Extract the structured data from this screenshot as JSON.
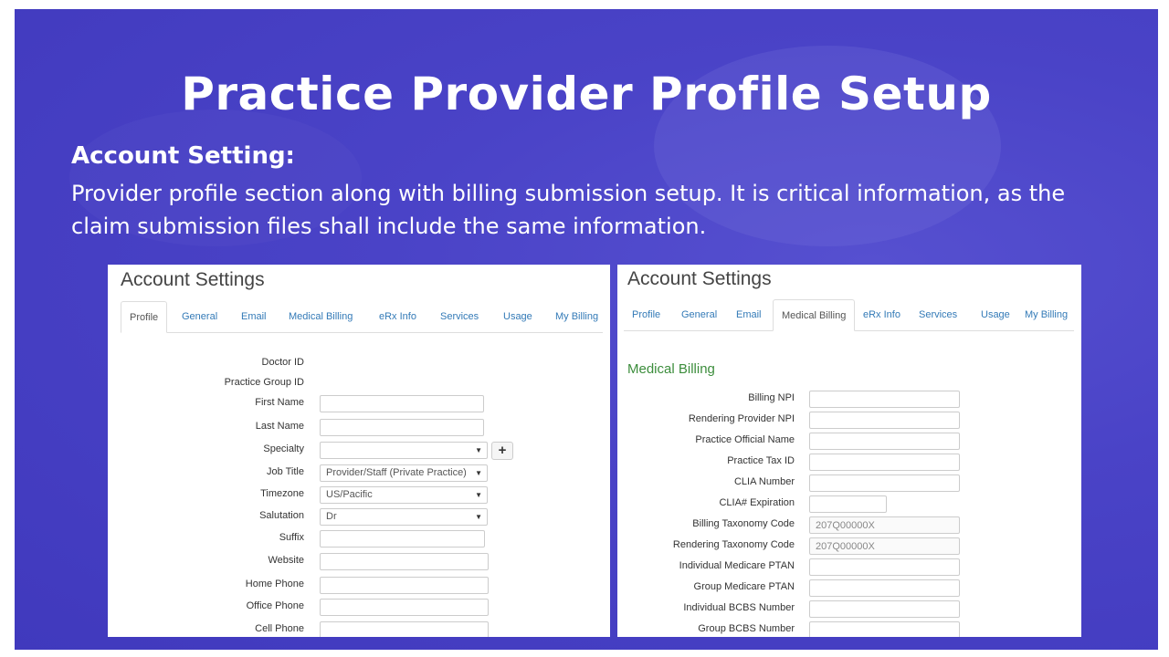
{
  "slide": {
    "title": "Practice Provider Profile Setup",
    "subhead": "Account Setting:",
    "description": "Provider profile section along with billing submission setup. It is critical information, as the claim submission files shall include the same information."
  },
  "profile_panel": {
    "title": "Account Settings",
    "tabs": [
      "Profile",
      "General",
      "Email",
      "Medical Billing",
      "eRx Info",
      "Services",
      "Usage",
      "My Billing"
    ],
    "active_tab": "Profile",
    "labels": {
      "doctor_id": "Doctor ID",
      "practice_group_id": "Practice Group ID",
      "first_name": "First Name",
      "last_name": "Last Name",
      "specialty": "Specialty",
      "job_title": "Job Title",
      "timezone": "Timezone",
      "salutation": "Salutation",
      "suffix": "Suffix",
      "website": "Website",
      "home_phone": "Home Phone",
      "office_phone": "Office Phone",
      "cell_phone": "Cell Phone"
    },
    "values": {
      "first_name": "",
      "last_name": "",
      "specialty": "",
      "job_title": "Provider/Staff (Private Practice)",
      "timezone": "US/Pacific",
      "salutation": "Dr",
      "suffix": "",
      "website": "",
      "home_phone": "",
      "office_phone": "",
      "cell_phone": ""
    },
    "add_specialty_label": "+"
  },
  "billing_panel": {
    "title": "Account Settings",
    "tabs": [
      "Profile",
      "General",
      "Email",
      "Medical Billing",
      "eRx Info",
      "Services",
      "Usage",
      "My Billing"
    ],
    "active_tab": "Medical Billing",
    "section_heading": "Medical Billing",
    "labels": {
      "billing_npi": "Billing NPI",
      "rendering_provider_npi": "Rendering Provider NPI",
      "practice_official_name": "Practice Official Name",
      "practice_tax_id": "Practice Tax ID",
      "clia_number": "CLIA Number",
      "clia_expiration": "CLIA# Expiration",
      "billing_taxonomy_code": "Billing Taxonomy Code",
      "rendering_taxonomy_code": "Rendering Taxonomy Code",
      "individual_medicare_ptan": "Individual Medicare PTAN",
      "group_medicare_ptan": "Group Medicare PTAN",
      "individual_bcbs_number": "Individual BCBS Number",
      "group_bcbs_number": "Group BCBS Number"
    },
    "values": {
      "billing_npi": "",
      "rendering_provider_npi": "",
      "practice_official_name": "",
      "practice_tax_id": "",
      "clia_number": "",
      "clia_expiration": "",
      "billing_taxonomy_code": "207Q00000X",
      "rendering_taxonomy_code": "207Q00000X",
      "individual_medicare_ptan": "",
      "group_medicare_ptan": "",
      "individual_bcbs_number": "",
      "group_bcbs_number": ""
    }
  },
  "colors": {
    "slide_background": "#4a43c7",
    "tab_link": "#337ab7",
    "section_heading": "#3c8d3c"
  }
}
